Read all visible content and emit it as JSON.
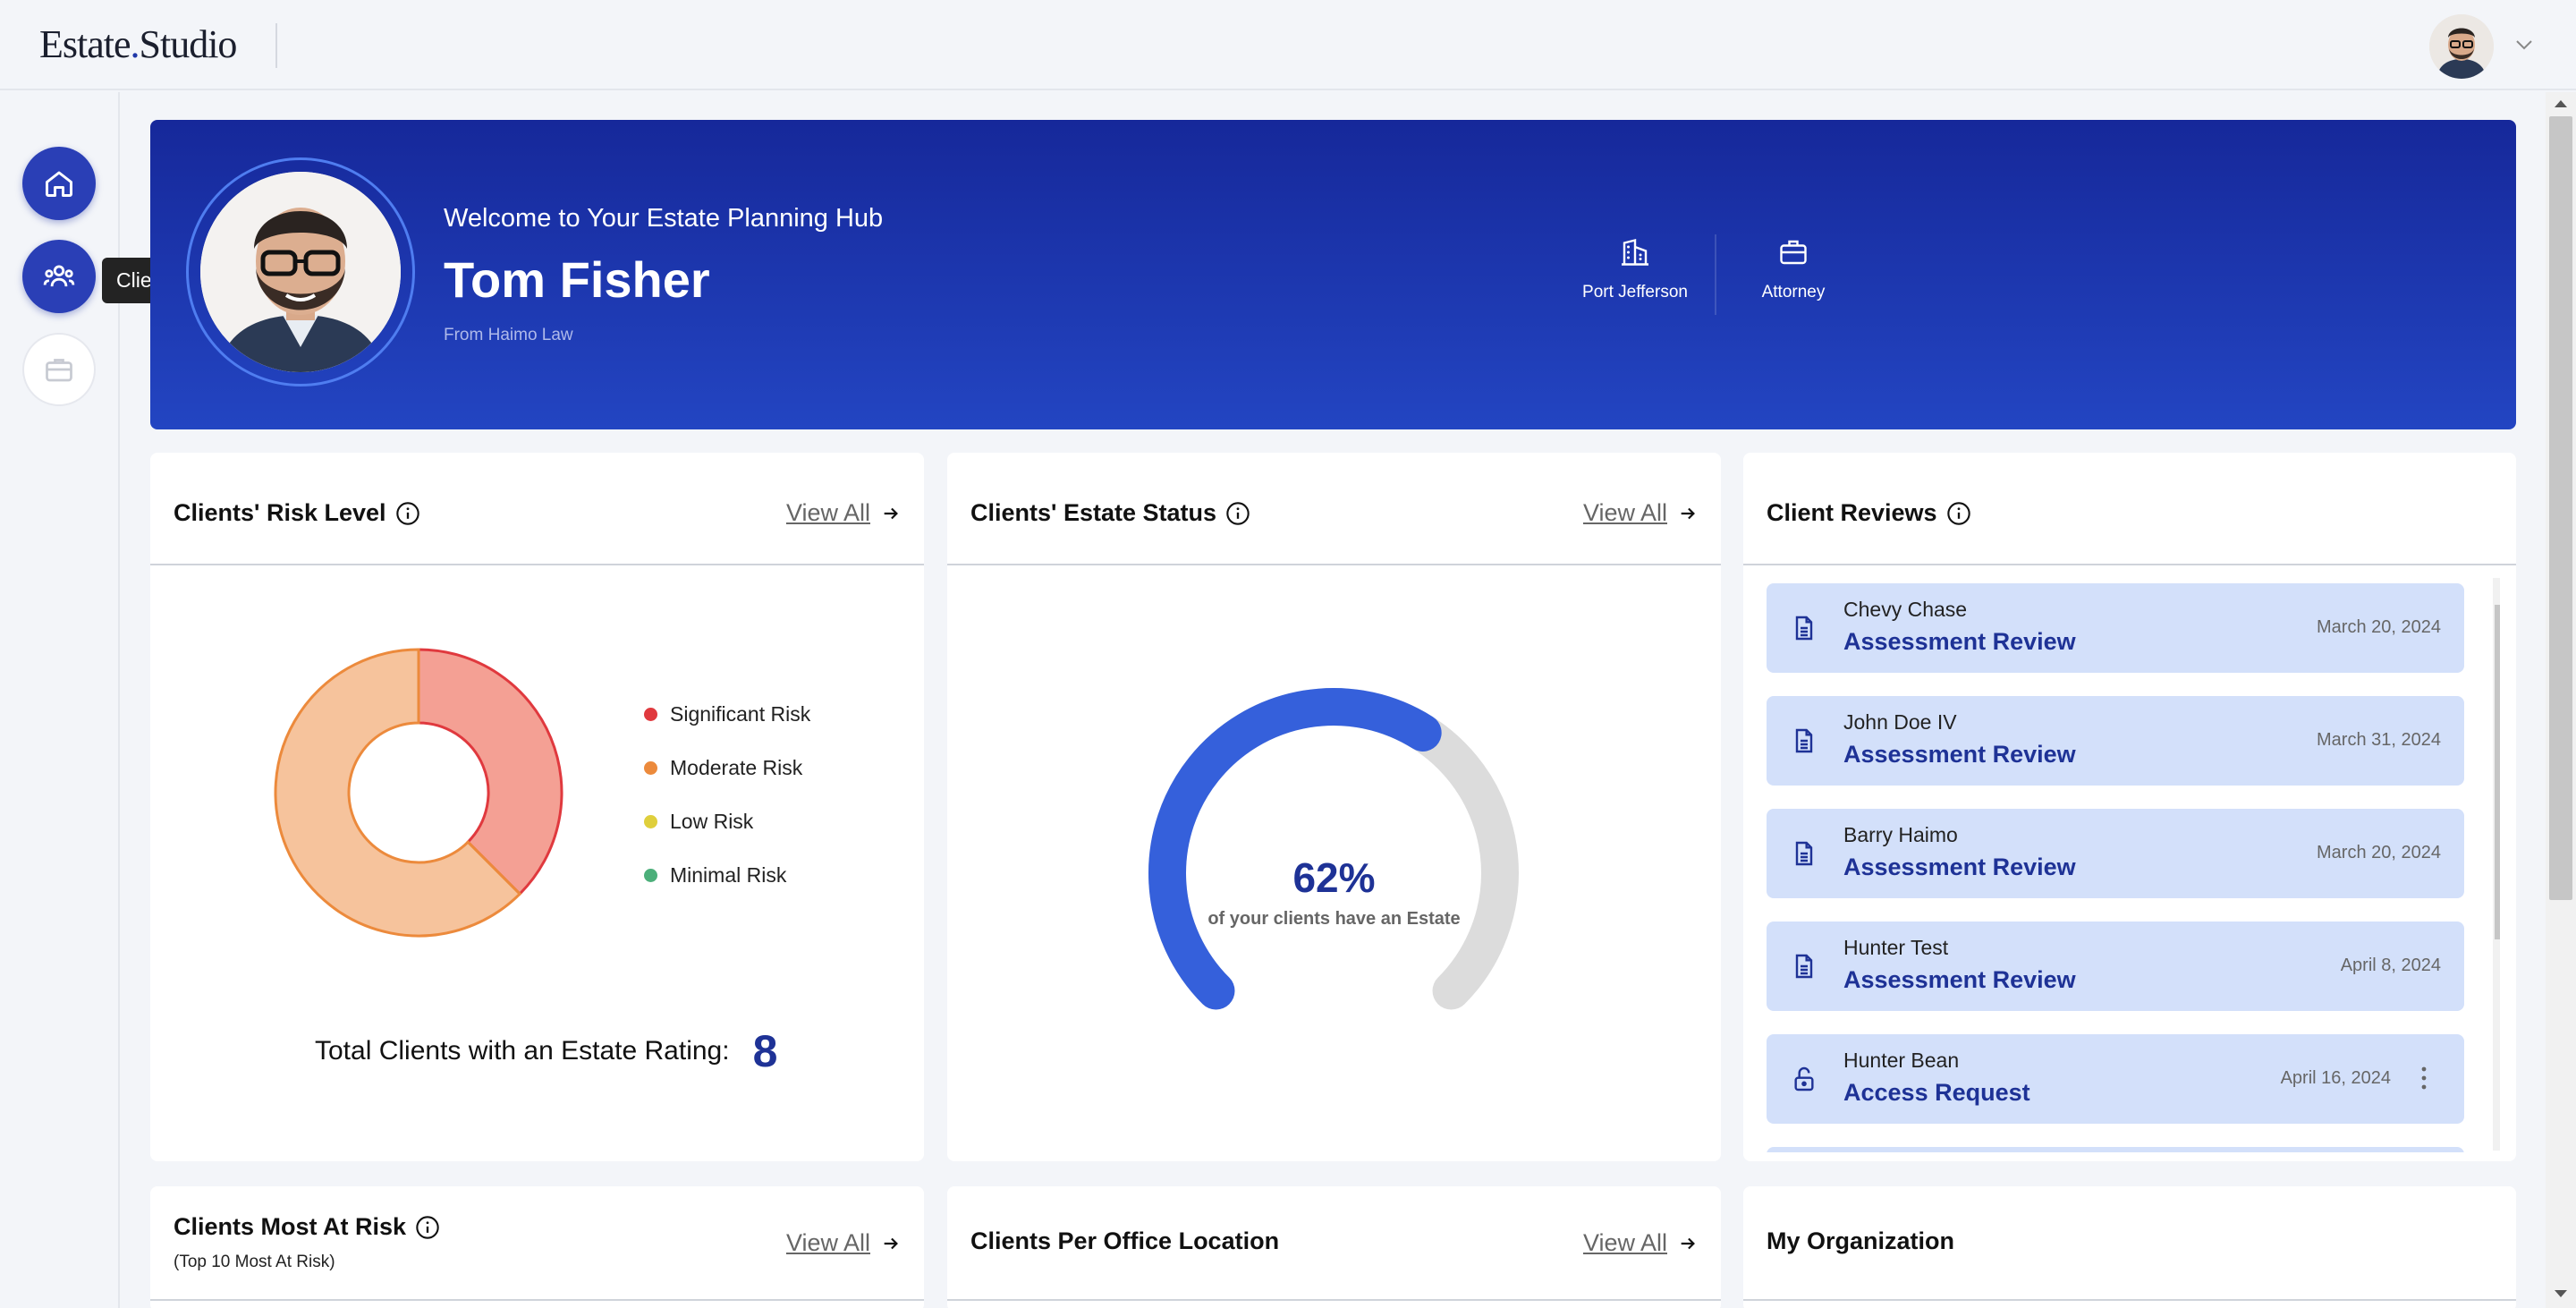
{
  "app": {
    "logo_left": "Estate",
    "logo_dot": ".",
    "logo_right": "Studio"
  },
  "sidebar": {
    "items": [
      {
        "icon": "home-icon",
        "label": "Home",
        "active": true
      },
      {
        "icon": "clients-icon",
        "label": "Clients",
        "active": true
      },
      {
        "icon": "briefcase-icon",
        "label": "Briefcase",
        "active": false
      }
    ],
    "tooltip": "Clients"
  },
  "hero": {
    "welcome": "Welcome to Your Estate Planning Hub",
    "name": "Tom Fisher",
    "from": "From Haimo Law",
    "location": "Port Jefferson",
    "role": "Attorney"
  },
  "risk_card": {
    "title": "Clients' Risk Level",
    "view_all": "View All",
    "legend": [
      {
        "label": "Significant Risk",
        "color": "#e0393e"
      },
      {
        "label": "Moderate Risk",
        "color": "#ec8a3c"
      },
      {
        "label": "Low Risk",
        "color": "#dfcf3c"
      },
      {
        "label": "Minimal Risk",
        "color": "#4caf7a"
      }
    ],
    "total_label": "Total Clients with an Estate Rating:",
    "total_value": "8"
  },
  "estate_card": {
    "title": "Clients' Estate Status",
    "view_all": "View All",
    "percent": "62%",
    "subtitle": "of your clients have an Estate",
    "fraction": 0.62
  },
  "reviews_card": {
    "title": "Client Reviews",
    "items": [
      {
        "name": "Chevy Chase",
        "type": "Assessment Review",
        "date": "March 20, 2024",
        "icon": "document-icon"
      },
      {
        "name": "John Doe IV",
        "type": "Assessment Review",
        "date": "March 31, 2024",
        "icon": "document-icon"
      },
      {
        "name": "Barry Haimo",
        "type": "Assessment Review",
        "date": "March 20, 2024",
        "icon": "document-icon"
      },
      {
        "name": "Hunter Test",
        "type": "Assessment Review",
        "date": "April 8, 2024",
        "icon": "document-icon"
      },
      {
        "name": "Hunter Bean",
        "type": "Access Request",
        "date": "April 16, 2024",
        "icon": "unlock-icon"
      }
    ]
  },
  "bottom_cards": {
    "most_at_risk": {
      "title": "Clients Most At Risk",
      "subtitle": "(Top 10 Most At Risk)",
      "view_all": "View All"
    },
    "per_office": {
      "title": "Clients Per Office Location",
      "view_all": "View All"
    },
    "organization": {
      "title": "My Organization"
    }
  },
  "chart_data": {
    "type": "pie",
    "categories": [
      "Significant Risk",
      "Moderate Risk",
      "Low Risk",
      "Minimal Risk"
    ],
    "values": [
      3,
      5,
      0,
      0
    ],
    "colors": [
      "#f4a094",
      "#f6c39c",
      "#f2e6a0",
      "#a6dcbd"
    ],
    "stroke_colors": [
      "#e0393e",
      "#ec8a3c",
      "#dfcf3c",
      "#4caf7a"
    ]
  }
}
